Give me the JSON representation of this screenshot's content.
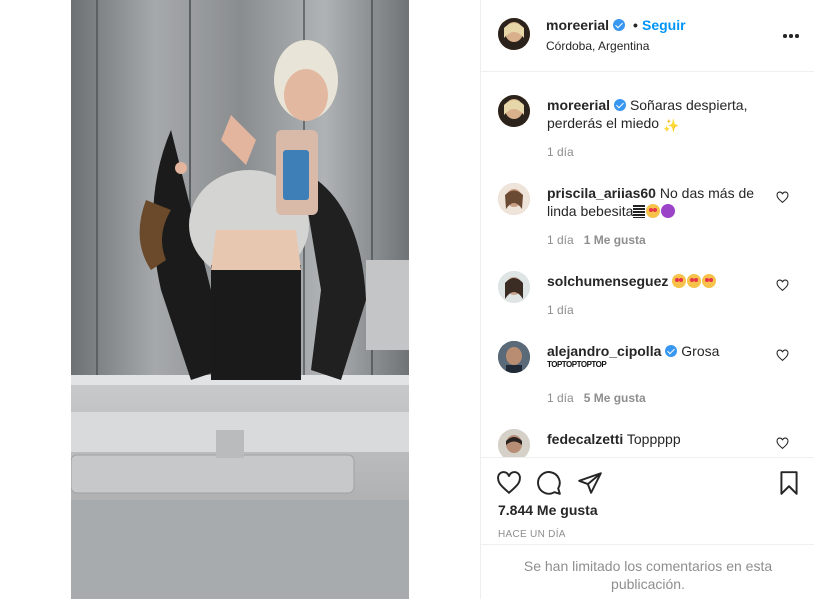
{
  "post": {
    "username": "moreerial",
    "dot": "•",
    "follow_label": "Seguir",
    "location": "Córdoba, Argentina"
  },
  "comments": [
    {
      "user": "moreerial",
      "verified": true,
      "text": "Soñaras despierta, perderás el miedo",
      "emoji": "sparkles",
      "time": "1 día",
      "likes": ""
    },
    {
      "user": "priscila_ariias60",
      "verified": false,
      "text": "No das más de linda bebesita",
      "emoji": "bars heart-eyes devil",
      "time": "1 día",
      "likes": "1 Me gusta"
    },
    {
      "user": "solchumenseguez",
      "verified": false,
      "text": "",
      "emoji": "heart-eyes heart-eyes heart-eyes",
      "time": "1 día",
      "likes": ""
    },
    {
      "user": "alejandro_cipolla",
      "verified": true,
      "text": "Grosa",
      "extra": "TOPTOPTOPTOP",
      "time": "1 día",
      "likes": "5 Me gusta"
    },
    {
      "user": "fedecalzetti",
      "verified": false,
      "text": "Toppppp",
      "time": "",
      "likes": ""
    }
  ],
  "stats": {
    "likes": "7.844 Me gusta",
    "time_ago": "Hace un día",
    "limited_notice": "Se han limitado los comentarios en esta publicación."
  },
  "icons": {
    "like": "heart-icon",
    "comment": "comment-icon",
    "share": "share-icon",
    "save": "bookmark-icon",
    "more": "more-options-icon"
  },
  "colors": {
    "accent": "#0095f6",
    "verified": "#3897f0",
    "muted": "#8e8e8e",
    "text": "#262626"
  }
}
